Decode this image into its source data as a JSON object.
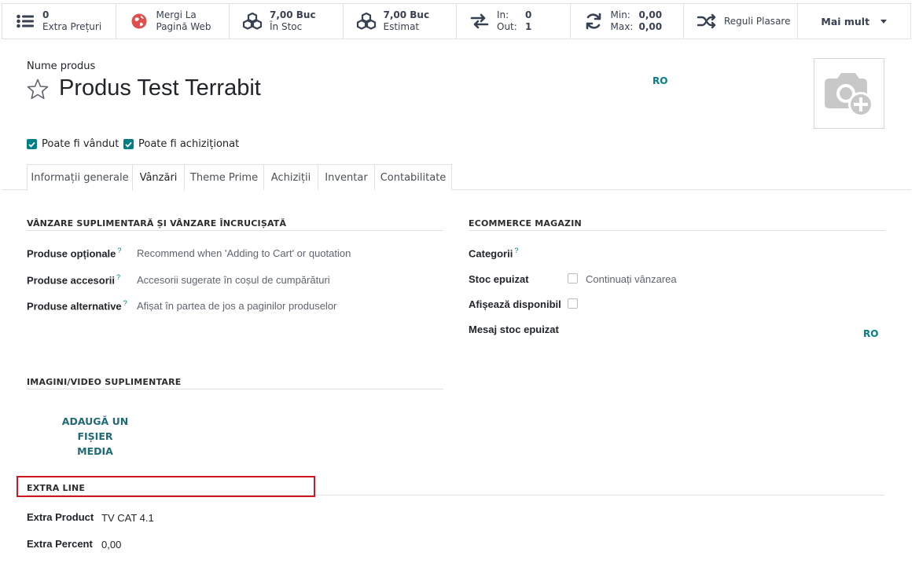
{
  "smart_buttons": {
    "extra_prices": {
      "value": "0",
      "label": "Extra Prețuri",
      "icon": "list-icon"
    },
    "website": {
      "line1": "Mergi La",
      "line2": "Pagină Web",
      "icon": "globe-icon",
      "color": "#e04d4d"
    },
    "on_hand": {
      "value": "7,00 Buc",
      "label": "În Stoc",
      "icon": "cubes-icon"
    },
    "forecast": {
      "value": "7,00 Buc",
      "label": "Estimat",
      "icon": "cubes-icon"
    },
    "in_out": {
      "in_label": "In:",
      "in_value": "0",
      "out_label": "Out:",
      "out_value": "1",
      "icon": "exchange-icon"
    },
    "min_max": {
      "min_label": "Min:",
      "min_value": "0,00",
      "max_label": "Max:",
      "max_value": "0,00",
      "icon": "refresh-icon"
    },
    "putaway": {
      "label": "Reguli Plasare",
      "icon": "random-icon"
    },
    "more": {
      "label": "Mai mult"
    }
  },
  "header": {
    "product_name_label": "Nume produs",
    "product_name": "Produs Test Terrabit",
    "lang_code": "RO",
    "can_be_sold_label": "Poate fi vândut",
    "can_be_purchased_label": "Poate fi achiziționat",
    "can_be_sold": true,
    "can_be_purchased": true
  },
  "tabs": [
    {
      "label": "Informații generale",
      "active": false
    },
    {
      "label": "Vânzări",
      "active": true
    },
    {
      "label": "Theme Prime",
      "active": false
    },
    {
      "label": "Achiziții",
      "active": false
    },
    {
      "label": "Inventar",
      "active": false
    },
    {
      "label": "Contabilitate",
      "active": false
    }
  ],
  "upsell": {
    "heading": "VÂNZARE SUPLIMENTARĂ ȘI VÂNZARE ÎNCRUCIȘATĂ",
    "fields": [
      {
        "label": "Produse opționale",
        "help": "?",
        "placeholder": "Recommend when 'Adding to Cart' or quotation"
      },
      {
        "label": "Produse accesorii",
        "help": "?",
        "placeholder": "Accesorii sugerate în coșul de cumpărături"
      },
      {
        "label": "Produse alternative",
        "help": "?",
        "placeholder": "Afișat în partea de jos a paginilor produselor"
      }
    ]
  },
  "ecommerce": {
    "heading": "ECOMMERCE MAGAZIN",
    "categories_label": "Categorii",
    "categories_help": "?",
    "out_of_stock_label": "Stoc epuizat",
    "continue_selling_label": "Continuați vânzarea",
    "show_available_label": "Afișează disponibil",
    "out_of_stock_msg_label": "Mesaj stoc epuizat",
    "lang_code": "RO"
  },
  "media": {
    "heading": "IMAGINI/VIDEO SUPLIMENTARE",
    "add_line1": "ADAUGĂ UN FIȘIER",
    "add_line2": "MEDIA"
  },
  "extra_line": {
    "heading": "EXTRA LINE",
    "product_label": "Extra Product",
    "product_value": "TV CAT 4.1",
    "percent_label": "Extra Percent",
    "percent_value": "0,00"
  },
  "colors": {
    "accent": "#017e84",
    "highlight": "#d0161f"
  }
}
